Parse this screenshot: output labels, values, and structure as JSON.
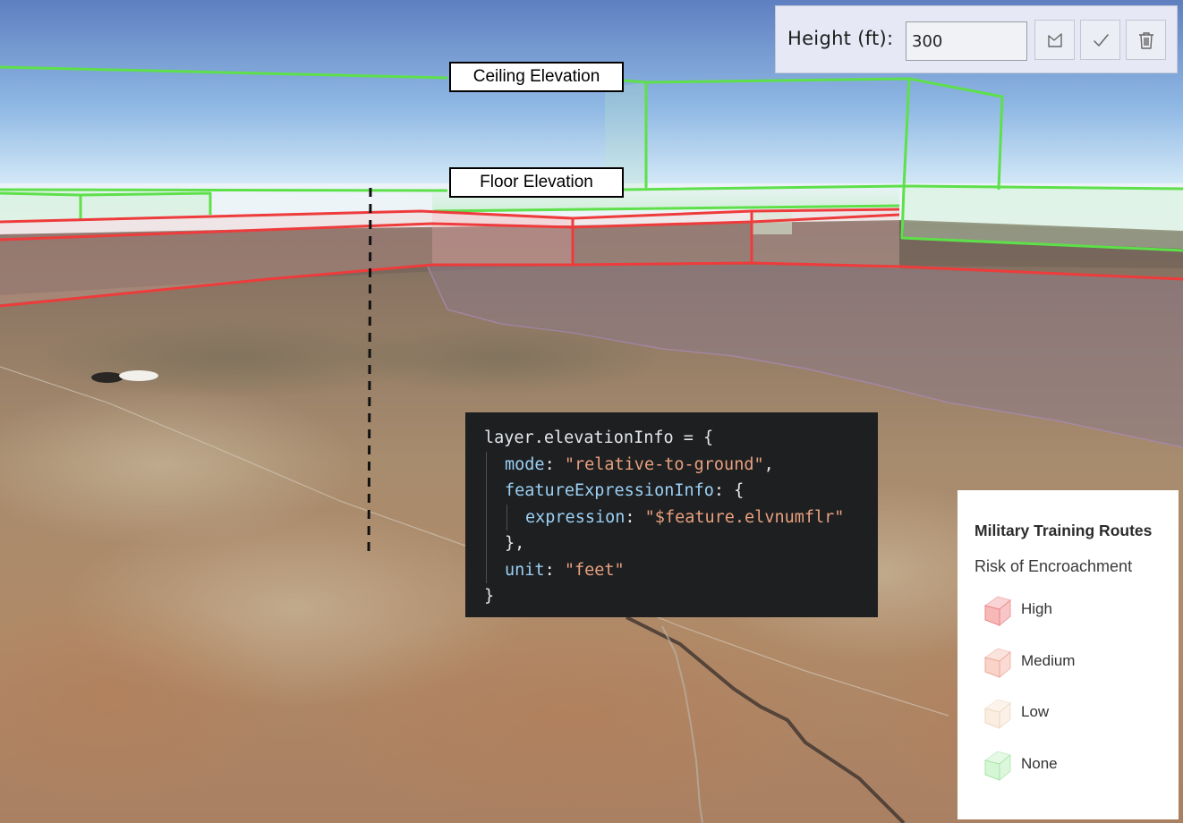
{
  "toolbar": {
    "height_label": "Height (ft):",
    "height_value": "300",
    "buttons": [
      {
        "name": "draw-polygon-button",
        "icon": "polygon-draw-icon"
      },
      {
        "name": "apply-button",
        "icon": "checkmark-icon"
      },
      {
        "name": "delete-button",
        "icon": "trash-icon"
      }
    ]
  },
  "annotations": {
    "ceiling": "Ceiling Elevation",
    "floor": "Floor Elevation"
  },
  "code": {
    "lines": [
      {
        "indent": 0,
        "tokens": [
          [
            "p",
            "layer.elevationInfo = {"
          ]
        ]
      },
      {
        "indent": 1,
        "tokens": [
          [
            "k",
            "mode"
          ],
          [
            "p",
            ": "
          ],
          [
            "s",
            "\"relative-to-ground\""
          ],
          [
            "p",
            ","
          ]
        ]
      },
      {
        "indent": 1,
        "tokens": [
          [
            "k",
            "featureExpressionInfo"
          ],
          [
            "p",
            ": {"
          ]
        ]
      },
      {
        "indent": 2,
        "tokens": [
          [
            "k",
            "expression"
          ],
          [
            "p",
            ": "
          ],
          [
            "s",
            "\"$feature.elvnumflr\""
          ]
        ]
      },
      {
        "indent": 1,
        "tokens": [
          [
            "p",
            "},"
          ]
        ]
      },
      {
        "indent": 1,
        "tokens": [
          [
            "k",
            "unit"
          ],
          [
            "p",
            ": "
          ],
          [
            "s",
            "\"feet\""
          ]
        ]
      },
      {
        "indent": 0,
        "tokens": [
          [
            "p",
            "}"
          ]
        ]
      }
    ]
  },
  "legend": {
    "title": "Military Training Routes",
    "subtitle": "Risk of Encroachment",
    "items": [
      {
        "label": "High",
        "color": "#f7b8b8",
        "stroke": "#e98686"
      },
      {
        "label": "Medium",
        "color": "#f9d2c8",
        "stroke": "#eba99a"
      },
      {
        "label": "Low",
        "color": "#fbeee0",
        "stroke": "#ecd8c2"
      },
      {
        "label": "None",
        "color": "#d5f6d5",
        "stroke": "#a8e4a8"
      }
    ]
  },
  "colors": {
    "ceiling_outline": "#5ee04a",
    "floor_outline": "#ee3b3b",
    "sky_top": "#6b87c4",
    "terrain": "#9c7e5e"
  }
}
